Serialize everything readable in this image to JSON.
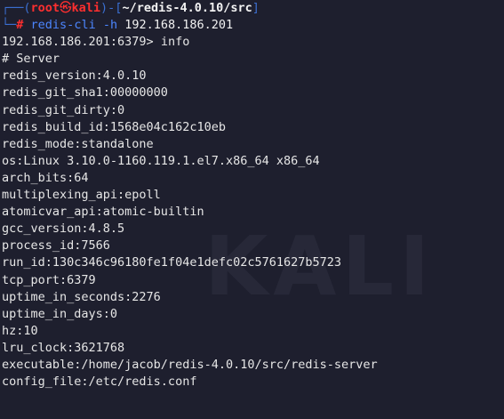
{
  "prompt": {
    "user": "root",
    "skull_icon": "skull-icon",
    "host": "kali",
    "cwd": "~/redis-4.0.10/src",
    "symbol": "#",
    "command_name": "redis-cli",
    "command_flag": "-h",
    "command_ip": "192.168.186.201"
  },
  "redis_prompt": {
    "text": "192.168.186.201:6379>",
    "command": "info"
  },
  "output": [
    "# Server",
    "redis_version:4.0.10",
    "redis_git_sha1:00000000",
    "redis_git_dirty:0",
    "redis_build_id:1568e04c162c10eb",
    "redis_mode:standalone",
    "os:Linux 3.10.0-1160.119.1.el7.x86_64 x86_64",
    "arch_bits:64",
    "multiplexing_api:epoll",
    "atomicvar_api:atomic-builtin",
    "gcc_version:4.8.5",
    "process_id:7566",
    "run_id:130c346c96180fe1f04e1defc02c5761627b5723",
    "tcp_port:6379",
    "uptime_in_seconds:2276",
    "uptime_in_days:0",
    "hz:10",
    "lru_clock:3621768",
    "executable:/home/jacob/redis-4.0.10/src/redis-server",
    "config_file:/etc/redis.conf"
  ],
  "colors": {
    "background": "#1e1f2e",
    "root_red": "#ff2f2f",
    "prompt_blue": "#3b6fd1",
    "command_blue": "#4c86ff",
    "text": "#e6e6e6"
  }
}
